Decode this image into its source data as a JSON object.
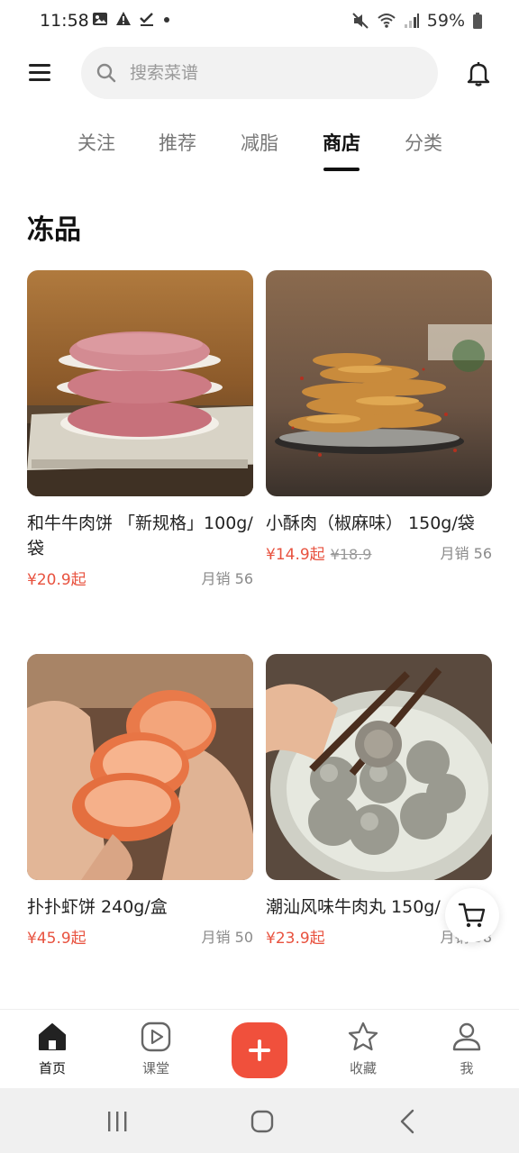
{
  "status_bar": {
    "time": "11:58",
    "battery": "59%",
    "left_icons": [
      "image-icon",
      "warning-icon",
      "check-icon",
      "dot-icon"
    ],
    "right_icons": [
      "mute-icon",
      "wifi-icon",
      "signal-icon",
      "battery-icon"
    ]
  },
  "header": {
    "search_placeholder": "搜索菜谱",
    "menu_icon": "menu-icon",
    "bell_icon": "bell-icon"
  },
  "tabs": [
    {
      "label": "关注",
      "active": false
    },
    {
      "label": "推荐",
      "active": false
    },
    {
      "label": "减脂",
      "active": false
    },
    {
      "label": "商店",
      "active": true
    },
    {
      "label": "分类",
      "active": false
    }
  ],
  "section": {
    "title": "冻品"
  },
  "products": [
    {
      "name": "和牛牛肉饼 「新规格」100g/袋",
      "price": "¥20.9起",
      "original_price": "",
      "sales": "月销 56"
    },
    {
      "name": "小酥肉（椒麻味） 150g/袋",
      "price": "¥14.9起",
      "original_price": "¥18.9",
      "sales": "月销 56"
    },
    {
      "name": "扑扑虾饼 240g/盒",
      "price": "¥45.9起",
      "original_price": "",
      "sales": "月销 50"
    },
    {
      "name": "潮汕风味牛肉丸 150g/",
      "price": "¥23.9起",
      "original_price": "",
      "sales": "月销 58"
    }
  ],
  "bottom_nav": [
    {
      "label": "首页",
      "icon": "home-icon",
      "active": true
    },
    {
      "label": "课堂",
      "icon": "play-icon",
      "active": false
    },
    {
      "label": "",
      "icon": "plus-icon",
      "active": false
    },
    {
      "label": "收藏",
      "icon": "star-icon",
      "active": false
    },
    {
      "label": "我",
      "icon": "user-icon",
      "active": false
    }
  ],
  "colors": {
    "accent": "#f0503c",
    "price": "#e8523f",
    "text": "#222222",
    "muted": "#8a8a8a"
  }
}
